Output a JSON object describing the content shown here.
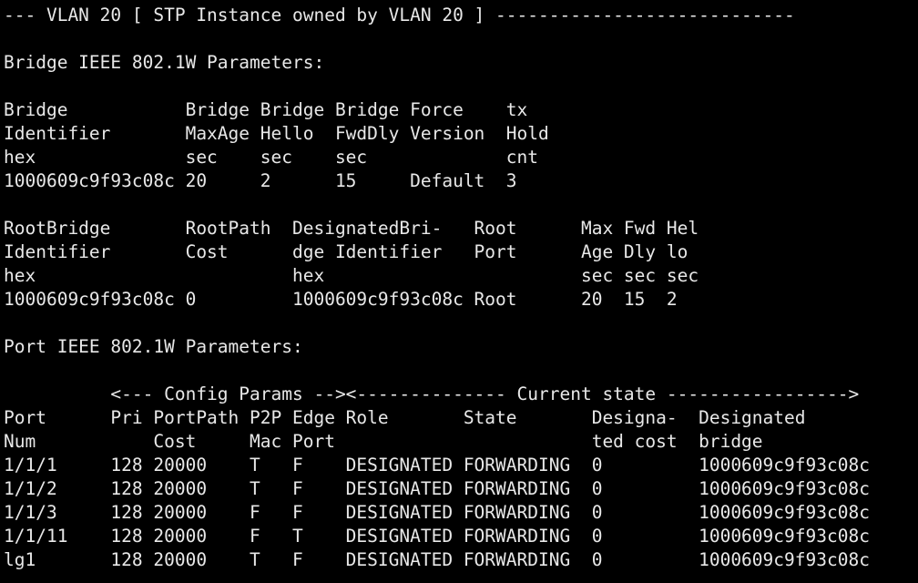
{
  "colors": {
    "background": "#000000",
    "foreground": "#e8e8e8"
  },
  "terminal": {
    "lines": [
      "--- VLAN 20 [ STP Instance owned by VLAN 20 ] ----------------------------",
      "",
      "Bridge IEEE 802.1W Parameters:",
      "",
      "Bridge           Bridge Bridge Bridge Force    tx",
      "Identifier       MaxAge Hello  FwdDly Version  Hold",
      "hex              sec    sec    sec             cnt",
      "1000609c9f93c08c 20     2      15     Default  3",
      "",
      "RootBridge       RootPath  DesignatedBri-   Root      Max Fwd Hel",
      "Identifier       Cost      dge Identifier   Port      Age Dly lo",
      "hex                        hex                        sec sec sec",
      "1000609c9f93c08c 0         1000609c9f93c08c Root      20  15  2",
      "",
      "Port IEEE 802.1W Parameters:",
      "",
      "          <--- Config Params --><-------------- Current state ----------------->",
      "Port      Pri PortPath P2P Edge Role       State       Designa-  Designated",
      "Num           Cost     Mac Port                        ted cost  bridge",
      "1/1/1     128 20000    T   F    DESIGNATED FORWARDING  0         1000609c9f93c08c",
      "1/1/2     128 20000    T   F    DESIGNATED FORWARDING  0         1000609c9f93c08c",
      "1/1/3     128 20000    F   F    DESIGNATED FORWARDING  0         1000609c9f93c08c",
      "1/1/11    128 20000    F   T    DESIGNATED FORWARDING  0         1000609c9f93c08c",
      "lg1       128 20000    T   F    DESIGNATED FORWARDING  0         1000609c9f93c08c"
    ]
  }
}
